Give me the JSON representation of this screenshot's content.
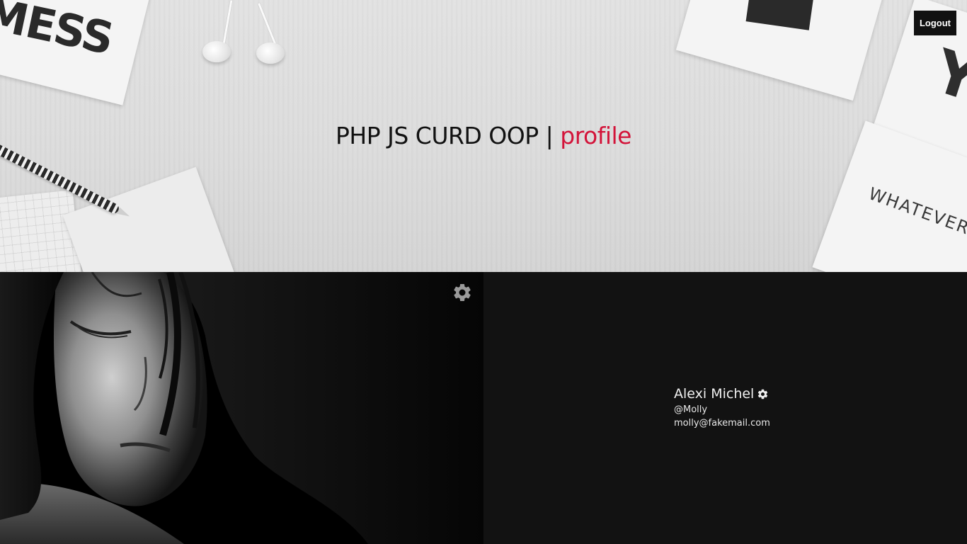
{
  "header": {
    "title_main": "PHP JS CURD OOP | ",
    "title_accent": "profile",
    "accent_color": "#d3143a",
    "logout_label": "Logout",
    "background_text": {
      "top_left": "MESS",
      "top_right": "YO",
      "bottom_right": "WHATEVER. FU"
    }
  },
  "profile": {
    "photo_alt": "profile-photo",
    "name": "Alexi Michel",
    "username": "@Molly",
    "email": "molly@fakemail.com"
  },
  "icons": {
    "photo_settings": "gear-icon",
    "name_settings": "gear-icon"
  }
}
